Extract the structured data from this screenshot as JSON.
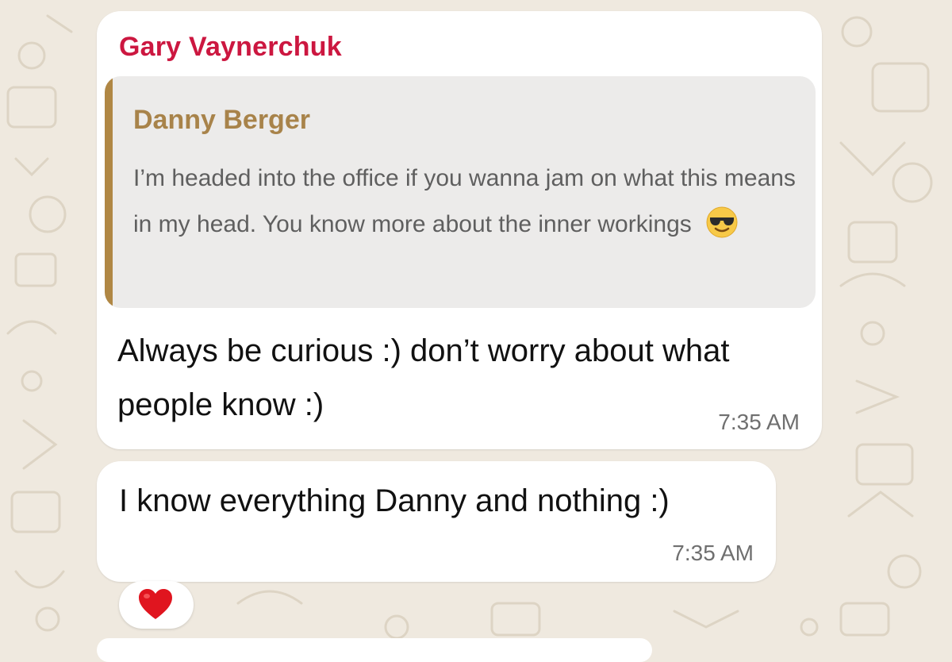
{
  "chat": {
    "messages": [
      {
        "sender": "Gary Vaynerchuk",
        "quote": {
          "author": "Danny Berger",
          "text": "I’m headed into the office if you wanna jam on what this means in my head. You know more about the inner workings",
          "emoji": "smiling-face-with-sunglasses"
        },
        "text": "Always be curious :) don’t worry about what people know :)",
        "time": "7:35 AM"
      },
      {
        "text": "I know everything Danny and nothing :)",
        "time": "7:35 AM",
        "reaction": "red-heart"
      }
    ]
  },
  "colors": {
    "background": "#efe9df",
    "bubble": "#ffffff",
    "sender_name": "#cc1740",
    "quote_bar": "#b08744",
    "quote_author": "#a8834a",
    "quote_background": "#ecebea"
  }
}
